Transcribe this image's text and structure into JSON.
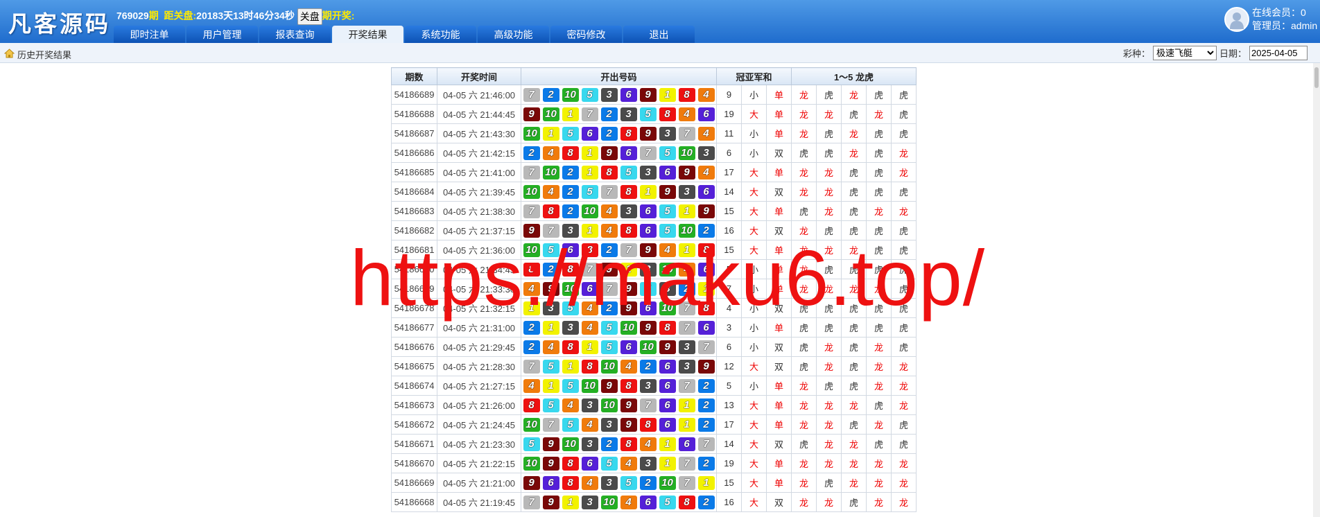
{
  "header": {
    "logo": "凡客源码",
    "period_no": "769029",
    "period_suffix": "期",
    "countdown_label": "距关盘:",
    "countdown_value": "20183天13时46分34秒",
    "close_btn": "关盘",
    "draw_suffix": "期开奖:",
    "online_label": "在线会员：0",
    "admin_label": "管理员：admin"
  },
  "nav": {
    "tabs": [
      "即时注单",
      "用户管理",
      "报表查询",
      "开奖结果",
      "系统功能",
      "高级功能",
      "密码修改",
      "退出"
    ],
    "active_index": 3
  },
  "subbar": {
    "breadcrumb": "历史开奖结果",
    "lottery_label": "彩种：",
    "lottery_value": "极速飞艇",
    "date_label": "日期：",
    "date_value": "2025-04-05"
  },
  "table": {
    "headers": [
      "期数",
      "开奖时间",
      "开出号码",
      "冠亚军和",
      "1～5 龙虎"
    ],
    "rows": [
      {
        "p": "54186689",
        "t": "04-05 六 21:46:00",
        "b": [
          7,
          2,
          10,
          5,
          3,
          6,
          9,
          1,
          8,
          4
        ],
        "s": "9",
        "dx": "小",
        "ds": "单",
        "lh": [
          "龙",
          "虎",
          "龙",
          "虎",
          "虎"
        ]
      },
      {
        "p": "54186688",
        "t": "04-05 六 21:44:45",
        "b": [
          9,
          10,
          1,
          7,
          2,
          3,
          5,
          8,
          4,
          6
        ],
        "s": "19",
        "dx": "大",
        "ds": "单",
        "lh": [
          "龙",
          "龙",
          "虎",
          "龙",
          "虎"
        ]
      },
      {
        "p": "54186687",
        "t": "04-05 六 21:43:30",
        "b": [
          10,
          1,
          5,
          6,
          2,
          8,
          9,
          3,
          7,
          4
        ],
        "s": "11",
        "dx": "小",
        "ds": "单",
        "lh": [
          "龙",
          "虎",
          "龙",
          "虎",
          "虎"
        ]
      },
      {
        "p": "54186686",
        "t": "04-05 六 21:42:15",
        "b": [
          2,
          4,
          8,
          1,
          9,
          6,
          7,
          5,
          10,
          3
        ],
        "s": "6",
        "dx": "小",
        "ds": "双",
        "lh": [
          "虎",
          "虎",
          "龙",
          "虎",
          "龙"
        ]
      },
      {
        "p": "54186685",
        "t": "04-05 六 21:41:00",
        "b": [
          7,
          10,
          2,
          1,
          8,
          5,
          3,
          6,
          9,
          4
        ],
        "s": "17",
        "dx": "大",
        "ds": "单",
        "lh": [
          "龙",
          "龙",
          "虎",
          "虎",
          "龙"
        ]
      },
      {
        "p": "54186684",
        "t": "04-05 六 21:39:45",
        "b": [
          10,
          4,
          2,
          5,
          7,
          8,
          1,
          9,
          3,
          6
        ],
        "s": "14",
        "dx": "大",
        "ds": "双",
        "lh": [
          "龙",
          "龙",
          "虎",
          "虎",
          "虎"
        ]
      },
      {
        "p": "54186683",
        "t": "04-05 六 21:38:30",
        "b": [
          7,
          8,
          2,
          10,
          4,
          3,
          6,
          5,
          1,
          9
        ],
        "s": "15",
        "dx": "大",
        "ds": "单",
        "lh": [
          "虎",
          "龙",
          "虎",
          "龙",
          "龙"
        ]
      },
      {
        "p": "54186682",
        "t": "04-05 六 21:37:15",
        "b": [
          9,
          7,
          3,
          1,
          4,
          8,
          6,
          5,
          10,
          2
        ],
        "s": "16",
        "dx": "大",
        "ds": "双",
        "lh": [
          "龙",
          "虎",
          "虎",
          "虎",
          "虎"
        ]
      },
      {
        "p": "54186681",
        "t": "04-05 六 21:36:00",
        "b": [
          10,
          5,
          6,
          8,
          2,
          7,
          9,
          4,
          1,
          8
        ],
        "s": "15",
        "dx": "大",
        "ds": "单",
        "lh": [
          "龙",
          "龙",
          "龙",
          "虎",
          "虎"
        ]
      },
      {
        "p": "54186680",
        "t": "04-05 六 21:34:45",
        "b": [
          8,
          2,
          8,
          7,
          9,
          1,
          3,
          10,
          4,
          6
        ],
        "s": "5",
        "dx": "小",
        "ds": "单",
        "lh": [
          "龙",
          "虎",
          "虎",
          "虎",
          "虎"
        ]
      },
      {
        "p": "54186679",
        "t": "04-05 六 21:33:30",
        "b": [
          4,
          9,
          10,
          6,
          7,
          9,
          5,
          3,
          2,
          1
        ],
        "s": "7",
        "dx": "小",
        "ds": "单",
        "lh": [
          "龙",
          "龙",
          "龙",
          "龙",
          "虎"
        ]
      },
      {
        "p": "54186678",
        "t": "04-05 六 21:32:15",
        "b": [
          1,
          3,
          5,
          4,
          2,
          9,
          6,
          10,
          7,
          8
        ],
        "s": "4",
        "dx": "小",
        "ds": "双",
        "lh": [
          "虎",
          "虎",
          "虎",
          "虎",
          "虎"
        ]
      },
      {
        "p": "54186677",
        "t": "04-05 六 21:31:00",
        "b": [
          2,
          1,
          3,
          4,
          5,
          10,
          9,
          8,
          7,
          6
        ],
        "s": "3",
        "dx": "小",
        "ds": "单",
        "lh": [
          "虎",
          "虎",
          "虎",
          "虎",
          "虎"
        ]
      },
      {
        "p": "54186676",
        "t": "04-05 六 21:29:45",
        "b": [
          2,
          4,
          8,
          1,
          5,
          6,
          10,
          9,
          3,
          7
        ],
        "s": "6",
        "dx": "小",
        "ds": "双",
        "lh": [
          "虎",
          "龙",
          "虎",
          "龙",
          "虎"
        ]
      },
      {
        "p": "54186675",
        "t": "04-05 六 21:28:30",
        "b": [
          7,
          5,
          1,
          8,
          10,
          4,
          2,
          6,
          3,
          9
        ],
        "s": "12",
        "dx": "大",
        "ds": "双",
        "lh": [
          "虎",
          "龙",
          "虎",
          "龙",
          "龙"
        ]
      },
      {
        "p": "54186674",
        "t": "04-05 六 21:27:15",
        "b": [
          4,
          1,
          5,
          10,
          9,
          8,
          3,
          6,
          7,
          2
        ],
        "s": "5",
        "dx": "小",
        "ds": "单",
        "lh": [
          "龙",
          "虎",
          "虎",
          "龙",
          "龙"
        ]
      },
      {
        "p": "54186673",
        "t": "04-05 六 21:26:00",
        "b": [
          8,
          5,
          4,
          3,
          10,
          9,
          7,
          6,
          1,
          2
        ],
        "s": "13",
        "dx": "大",
        "ds": "单",
        "lh": [
          "龙",
          "龙",
          "龙",
          "虎",
          "龙"
        ]
      },
      {
        "p": "54186672",
        "t": "04-05 六 21:24:45",
        "b": [
          10,
          7,
          5,
          4,
          3,
          9,
          8,
          6,
          1,
          2
        ],
        "s": "17",
        "dx": "大",
        "ds": "单",
        "lh": [
          "龙",
          "龙",
          "虎",
          "龙",
          "虎"
        ]
      },
      {
        "p": "54186671",
        "t": "04-05 六 21:23:30",
        "b": [
          5,
          9,
          10,
          3,
          2,
          8,
          4,
          1,
          6,
          7
        ],
        "s": "14",
        "dx": "大",
        "ds": "双",
        "lh": [
          "虎",
          "龙",
          "龙",
          "虎",
          "虎"
        ]
      },
      {
        "p": "54186670",
        "t": "04-05 六 21:22:15",
        "b": [
          10,
          9,
          8,
          6,
          5,
          4,
          3,
          1,
          7,
          2
        ],
        "s": "19",
        "dx": "大",
        "ds": "单",
        "lh": [
          "龙",
          "龙",
          "龙",
          "龙",
          "龙"
        ]
      },
      {
        "p": "54186669",
        "t": "04-05 六 21:21:00",
        "b": [
          9,
          6,
          8,
          4,
          3,
          5,
          2,
          10,
          7,
          1
        ],
        "s": "15",
        "dx": "大",
        "ds": "单",
        "lh": [
          "龙",
          "虎",
          "龙",
          "龙",
          "龙"
        ]
      },
      {
        "p": "54186668",
        "t": "04-05 六 21:19:45",
        "b": [
          7,
          9,
          1,
          3,
          10,
          4,
          6,
          5,
          8,
          2
        ],
        "s": "16",
        "dx": "大",
        "ds": "双",
        "lh": [
          "龙",
          "龙",
          "虎",
          "龙",
          "龙"
        ]
      }
    ]
  },
  "ball_colors": {
    "1": "#f2f200",
    "2": "#0a7ae8",
    "3": "#4b4b4b",
    "4": "#f07b0c",
    "5": "#38d8ee",
    "6": "#5520d8",
    "7": "#b8b8b8",
    "8": "#ee1111",
    "9": "#7a0808",
    "10": "#24b024"
  },
  "watermark": "https://maku6.top/"
}
